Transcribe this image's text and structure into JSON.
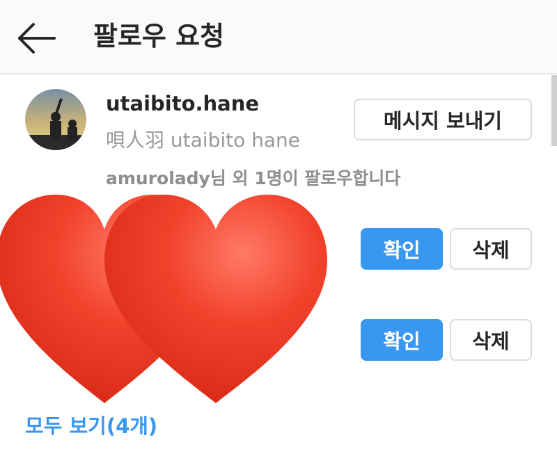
{
  "header": {
    "back_icon": "arrow-left-icon",
    "title": "팔로우 요청"
  },
  "suggestion": {
    "username": "utaibito.hane",
    "full_name": "唄人羽 utaibito hane",
    "mutual_text": "amurolady님 외 1명이 팔로우합니다",
    "message_button": "메시지 보내기"
  },
  "requests": [
    {
      "confirm_label": "확인",
      "delete_label": "삭제"
    },
    {
      "confirm_label": "확인",
      "delete_label": "삭제"
    }
  ],
  "see_all": "모두 보기(4개)",
  "colors": {
    "primary": "#3897f0",
    "heart": "#f2422c"
  },
  "overlay_icon": "heart-icon"
}
